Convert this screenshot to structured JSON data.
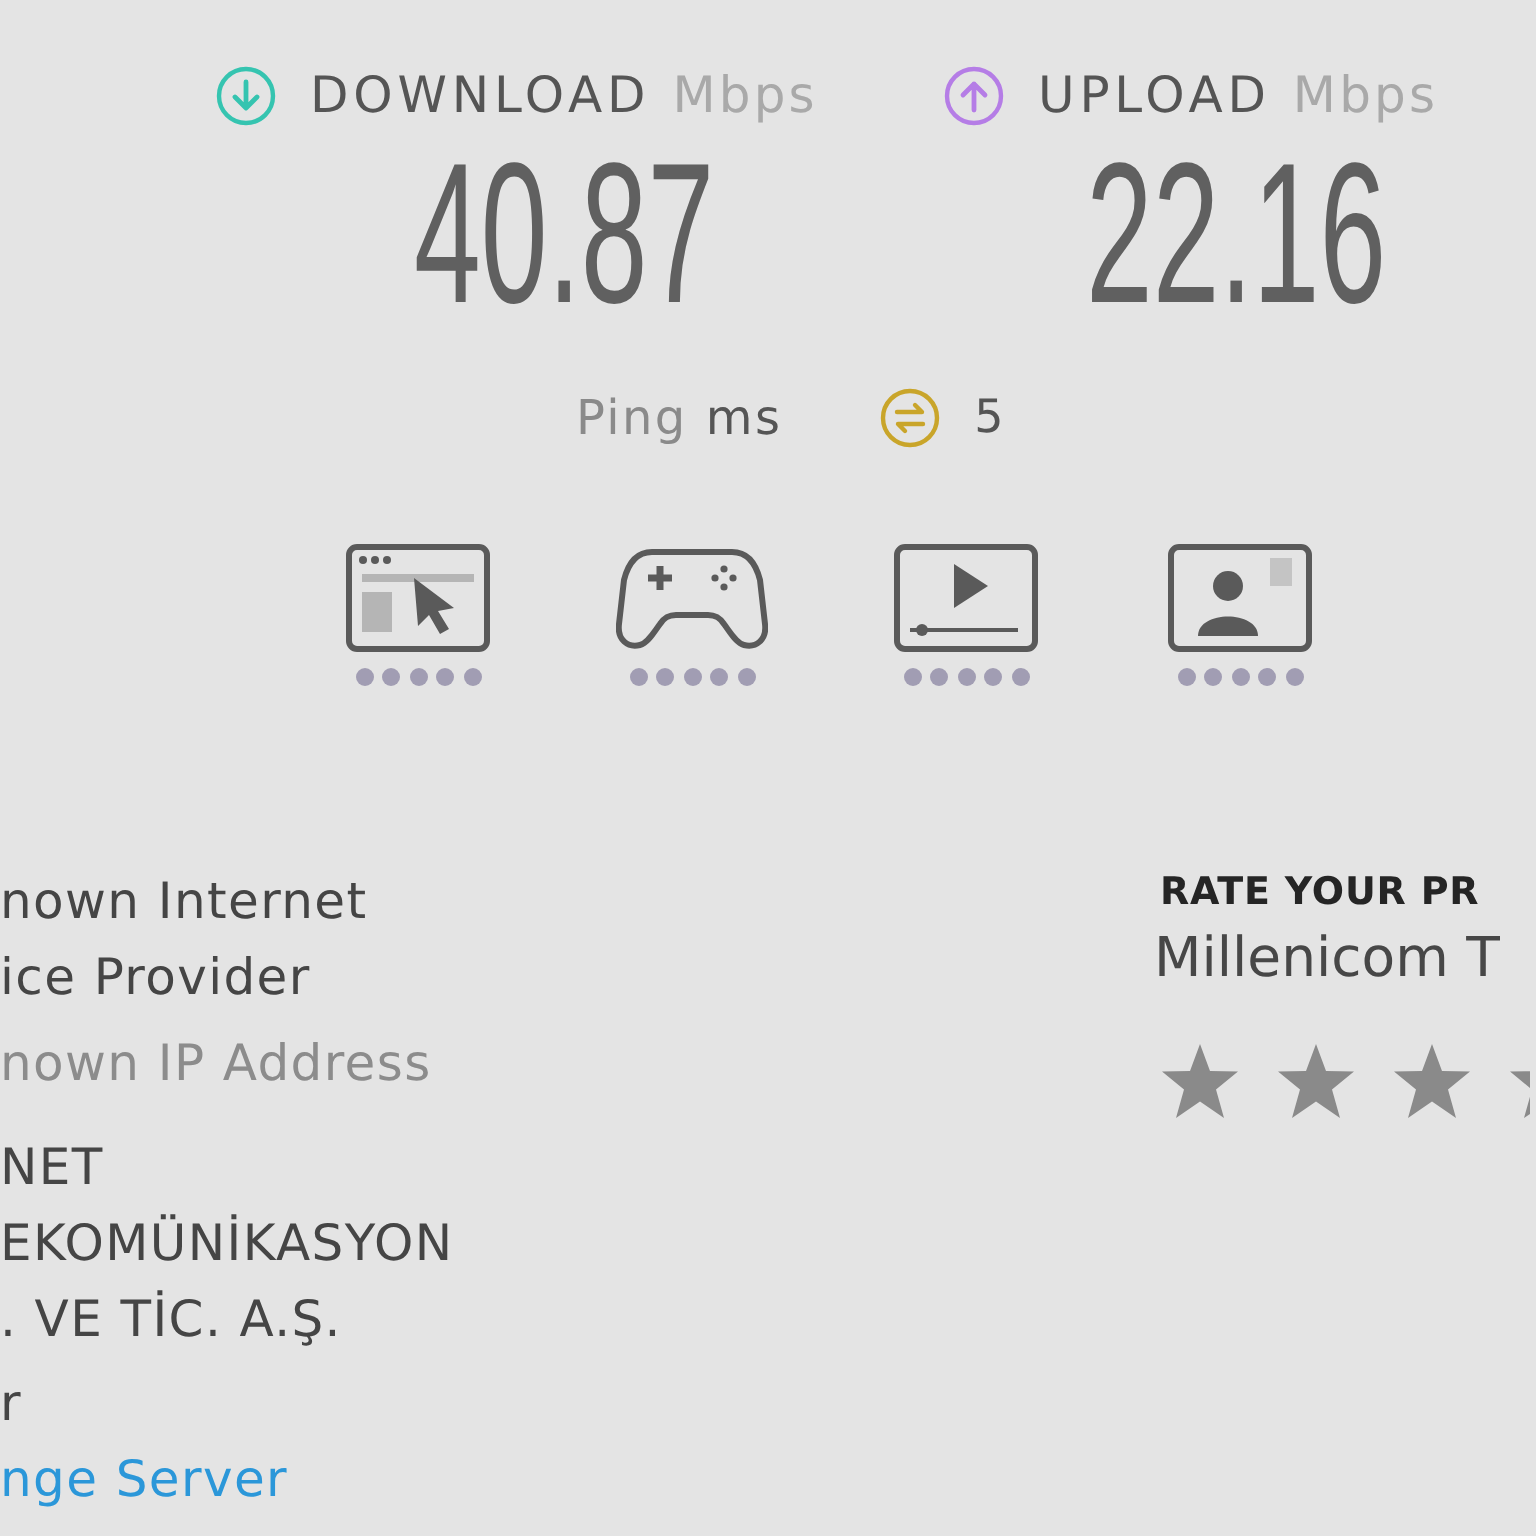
{
  "speeds": [
    {
      "kind": "download",
      "label": "DOWNLOAD",
      "unit": "Mbps",
      "value": "40.87"
    },
    {
      "kind": "upload",
      "label": "UPLOAD",
      "unit": "Mbps",
      "value": "22.16"
    }
  ],
  "ping": {
    "label": "Ping",
    "unit": "ms",
    "value": "5"
  },
  "activities": [
    {
      "kind": "browsing"
    },
    {
      "kind": "gaming"
    },
    {
      "kind": "streaming"
    },
    {
      "kind": "video_call"
    }
  ],
  "connection": {
    "provider_lines": [
      "nown Internet",
      "ice Provider"
    ],
    "ip_address": "nown IP Address",
    "server_lines": [
      "NET",
      "EKOMÜNİKASYON",
      ". VE TİC. A.Ş."
    ],
    "line_after_server": "r",
    "change_server_link": "nge Server"
  },
  "rating": {
    "heading": "RATE YOUR PR",
    "provider": "Millenicom T"
  }
}
